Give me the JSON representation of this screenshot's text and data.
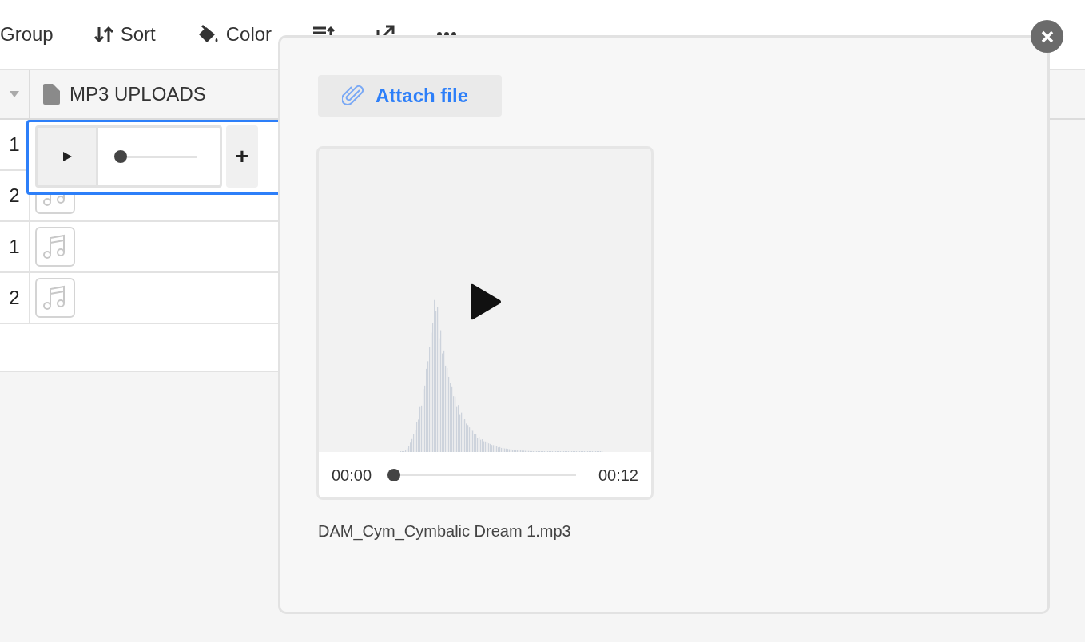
{
  "toolbar": [
    {
      "kind": "group",
      "label": "Group"
    },
    {
      "kind": "sort",
      "label": "Sort"
    },
    {
      "kind": "color",
      "label": "Color"
    },
    {
      "kind": "row-height"
    },
    {
      "kind": "share"
    },
    {
      "kind": "more"
    }
  ],
  "table": {
    "column": "MP3 UPLOADS",
    "rows": [
      {
        "number": "1",
        "kind": "editor",
        "level": 0,
        "add": "+"
      },
      {
        "number": "2",
        "kind": "file"
      },
      {
        "number": "1",
        "kind": "file"
      },
      {
        "number": "2",
        "kind": "file"
      }
    ]
  },
  "dialog": {
    "attach_button": "Attach file",
    "player": {
      "current": "00:00",
      "duration": "00:12",
      "level": 0
    },
    "file_name": "DAM_Cym_Cymbalic Dream 1.mp3"
  }
}
